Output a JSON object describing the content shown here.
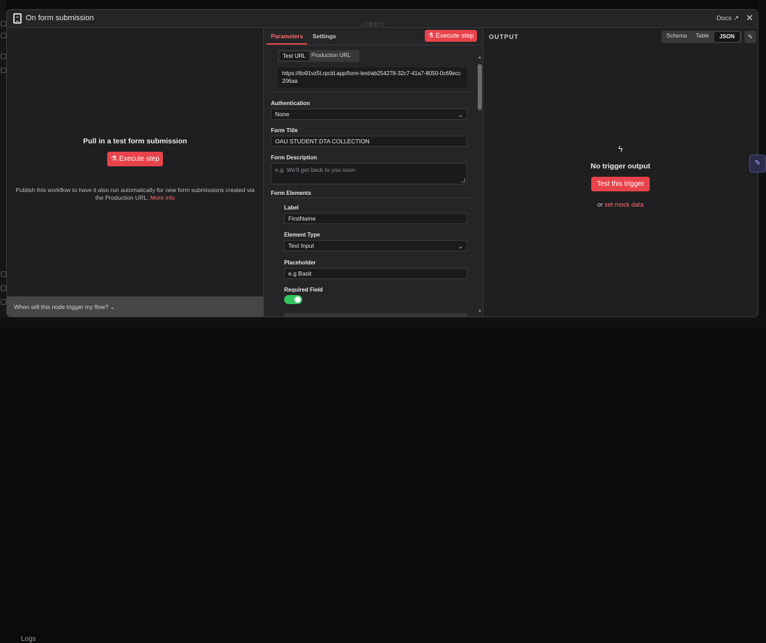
{
  "background": {
    "logs_label": "Logs"
  },
  "modal": {
    "title": "On form submission",
    "docs_label": "Docs ↗",
    "close_label": "✕",
    "drag_handle": "⋮⋮"
  },
  "input_panel": {
    "heading": "Pull in a test form submission",
    "execute_label": "⚗ Execute step",
    "publish_text": "Publish this workflow to have it also run automatically for new form submissions created via the Production URL.",
    "more_info": "More info",
    "footer_toggle": "When will this node trigger my flow?  ⌄"
  },
  "params": {
    "tabs": [
      "Parameters",
      "Settings"
    ],
    "execute_label": "⚗ Execute step",
    "url_tabs": [
      "Test URL",
      "Production URL"
    ],
    "url": "https://6o91vz5t.rpcld.app/form-test/ab254278-32c7-41a7-8050-0c69ecc206aa",
    "authentication_label": "Authentication",
    "authentication_value": "None",
    "form_title_label": "Form Title",
    "form_title_value": "OAU STUDENT DTA COLLECTION",
    "form_description_label": "Form Description",
    "form_description_placeholder": "e.g. We'll get back to you soon",
    "form_elements_label": "Form Elements",
    "element": {
      "label_label": "Label",
      "label_value": "FirstName",
      "type_label": "Element Type",
      "type_value": "Text Input",
      "placeholder_label": "Placeholder",
      "placeholder_value": "e.g Basit",
      "required_label": "Required Field",
      "required_on": true
    }
  },
  "output": {
    "title": "OUTPUT",
    "views": [
      "Schema",
      "Table",
      "JSON"
    ],
    "active_view": "JSON",
    "empty_title": "No trigger output",
    "test_label": "Test this trigger",
    "or_text": "or",
    "mock_link": "set mock data"
  },
  "colors": {
    "accent": "#e8434a",
    "toggle_on": "#35c45e",
    "panel": "#252527",
    "background": "#1f1f21"
  },
  "icons": [
    "form-icon",
    "external-link-icon",
    "close-icon",
    "flask-icon",
    "chevron-down-icon",
    "bolt-icon",
    "pencil-icon"
  ]
}
